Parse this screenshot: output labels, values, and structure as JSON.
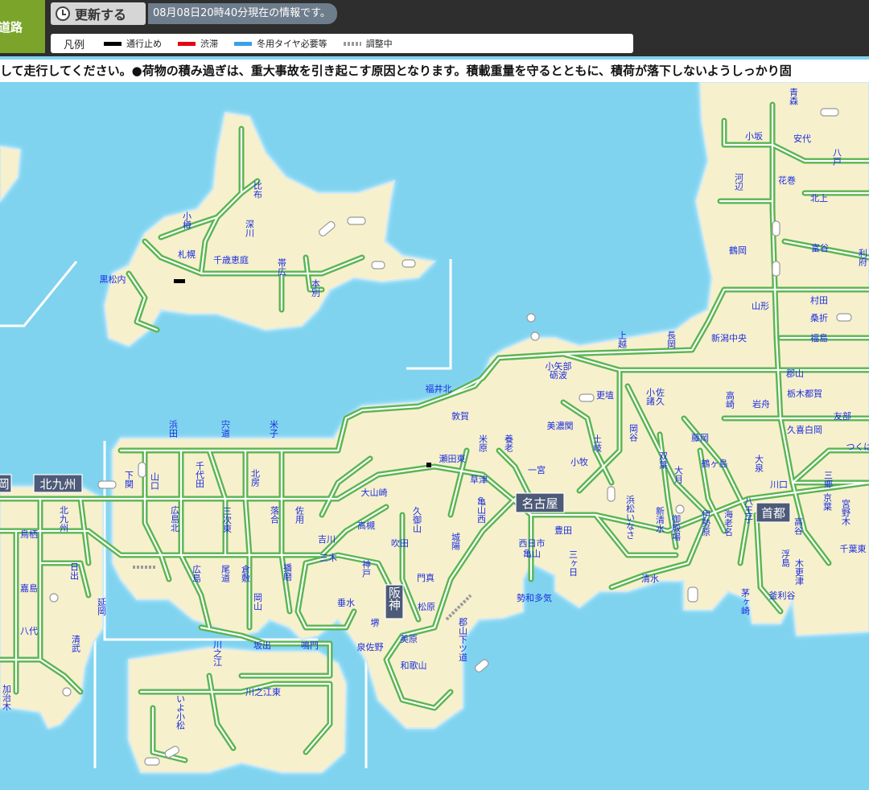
{
  "header": {
    "brand_label": "道路",
    "refresh_label": "更新する",
    "timestamp": "08月08日20時40分現在の情報です。"
  },
  "legend": {
    "title": "凡例",
    "items": [
      {
        "label": "通行止め",
        "color": "#000000"
      },
      {
        "label": "渋滞",
        "color": "#e60012"
      },
      {
        "label": "冬用タイヤ必要等",
        "color": "#3aa0ea"
      },
      {
        "label": "調整中",
        "color": "#9a9a9a"
      }
    ]
  },
  "ticker": "して走行してください。●荷物の積み過ぎは、重大事故を引き起こす原因となります。積載重量を守るとともに、積荷が落下しないようしっかり固",
  "map": {
    "colors": {
      "sea": "#7fd3ef",
      "land": "#f7f0cd",
      "road": "#5ab552",
      "road_core": "#ffffff"
    },
    "hubs": [
      "北九州",
      "名古屋",
      "首都",
      "阪神",
      "岡"
    ],
    "places": [
      "比布",
      "深川",
      "小樽",
      "札幌",
      "千歳恵庭",
      "帯広",
      "本別",
      "黒松内",
      "青森",
      "小坂",
      "安代",
      "八戸",
      "河辺",
      "花巻",
      "北上",
      "鶴岡",
      "富谷",
      "利府",
      "山形",
      "村田",
      "桑折",
      "福島",
      "上越",
      "長岡",
      "新潟中央",
      "小矢部",
      "砺波",
      "郡山",
      "福井北",
      "更埴",
      "小諸",
      "佐久",
      "高崎",
      "岩舟",
      "栃木都賀",
      "敦賀",
      "美濃関",
      "岡谷",
      "藤岡",
      "久喜白岡",
      "友部",
      "浜田",
      "宍道",
      "米子",
      "米原",
      "養老",
      "土岐",
      "双葉",
      "鶴ヶ島",
      "大泉",
      "三郷",
      "つくば",
      "下関",
      "山口",
      "千代田",
      "北房",
      "瀬田東",
      "一宮",
      "大月",
      "川口",
      "京葉",
      "大山崎",
      "草津",
      "小牧",
      "浜松いなさ",
      "新清水",
      "御殿場",
      "伊勢原",
      "八王子",
      "海老名",
      "高谷",
      "宮野木",
      "北九州",
      "広島北",
      "三次東",
      "落合",
      "佐用",
      "亀山西",
      "鳥栖",
      "吉川",
      "高槻",
      "久御山",
      "城陽",
      "豊田",
      "千葉東",
      "日出",
      "三木",
      "吹田",
      "西日市",
      "亀山",
      "三ヶ日",
      "浮島",
      "木更津",
      "嘉島",
      "広島",
      "尾道",
      "倉敷",
      "播磨",
      "神戸",
      "門真",
      "清水",
      "勢和多気",
      "茅ヶ崎",
      "釜利谷",
      "延岡",
      "岡山",
      "垂水",
      "松原",
      "八代",
      "清武",
      "川之江",
      "坂出",
      "鳴門",
      "堺",
      "泉佐野",
      "美原",
      "郡山下ツ道",
      "和歌山",
      "川之江東",
      "加治木",
      "いよ小松"
    ]
  }
}
